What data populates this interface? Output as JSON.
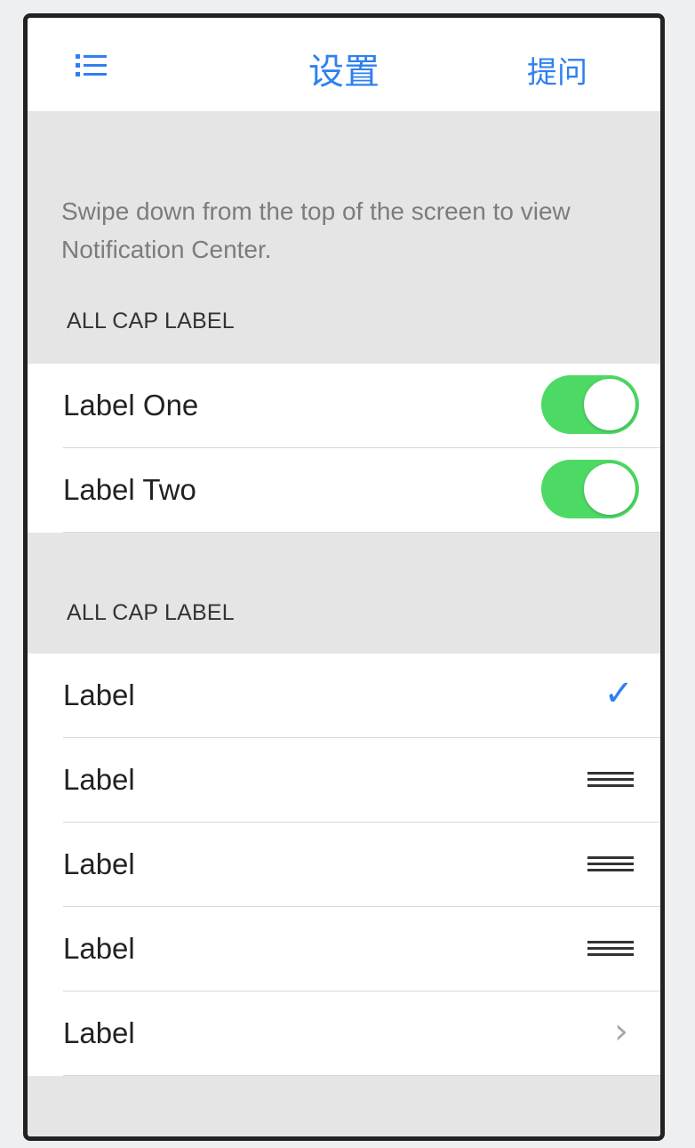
{
  "navbar": {
    "title": "设置",
    "right_action": "提问",
    "menu_icon": "list-icon",
    "accent_color": "#2f80f0"
  },
  "intro": {
    "text": "Swipe down from the top of the screen to view Notification Center."
  },
  "section1": {
    "header": "ALL CAP LABEL",
    "rows": [
      {
        "label": "Label One",
        "toggle_on": true
      },
      {
        "label": "Label Two",
        "toggle_on": true
      }
    ]
  },
  "section2": {
    "header": "ALL CAP LABEL",
    "rows": [
      {
        "label": "Label",
        "accessory": "checkmark-icon"
      },
      {
        "label": "Label",
        "accessory": "drag-handle-icon"
      },
      {
        "label": "Label",
        "accessory": "drag-handle-icon"
      },
      {
        "label": "Label",
        "accessory": "drag-handle-icon"
      },
      {
        "label": "Label",
        "accessory": "chevron-right-icon"
      }
    ]
  },
  "colors": {
    "toggle_on": "#4cd964",
    "background": "#e5e5e5"
  }
}
